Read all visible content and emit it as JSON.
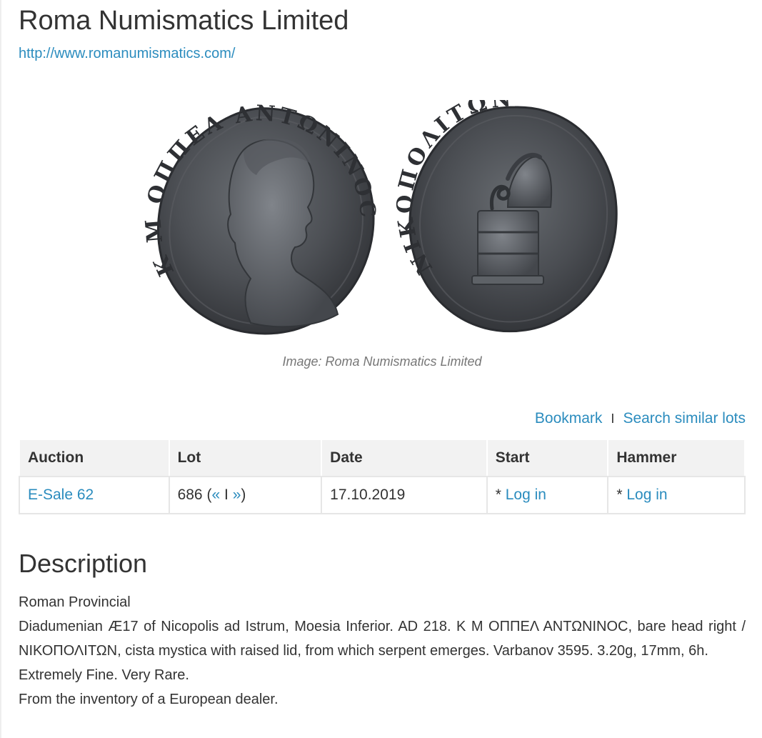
{
  "dealer": {
    "name": "Roma Numismatics Limited",
    "url": "http://www.romanumismatics.com/"
  },
  "image": {
    "caption": "Image: Roma Numismatics Limited",
    "obverse_legend": "K M ΟΠΠΕΛ ΑΝΤΩΝΙΝΟC",
    "reverse_legend": "ΝΙΚΟΠΟΛΙΤΩΝ"
  },
  "actions": {
    "bookmark": "Bookmark",
    "separator": "I",
    "search_similar": "Search similar lots"
  },
  "table": {
    "headers": {
      "auction": "Auction",
      "lot": "Lot",
      "date": "Date",
      "start": "Start",
      "hammer": "Hammer"
    },
    "row": {
      "auction": "E-Sale 62",
      "lot_number": "686",
      "prev": "«",
      "nav_sep": "I",
      "next": "»",
      "date": "17.10.2019",
      "start_prefix": "*",
      "start_link": "Log in",
      "hammer_prefix": "*",
      "hammer_link": "Log in"
    }
  },
  "description": {
    "title": "Description",
    "category": "Roman Provincial",
    "text": "Diadumenian Æ17 of Nicopolis ad Istrum, Moesia Inferior. AD 218. K M ΟΠΠΕΛ ΑΝΤΩΝΙΝΟC, bare head right / ΝΙΚΟΠΟΛΙΤΩΝ, cista mystica with raised lid, from which serpent emerges. Varbanov 3595. 3.20g, 17mm, 6h.",
    "grade": "Extremely Fine. Very Rare.",
    "provenance": "From the inventory of a European dealer."
  },
  "colors": {
    "link": "#2b8cbe",
    "text": "#333333",
    "table_header_bg": "#f2f2f2",
    "coin_metal": "#4a4d52"
  }
}
